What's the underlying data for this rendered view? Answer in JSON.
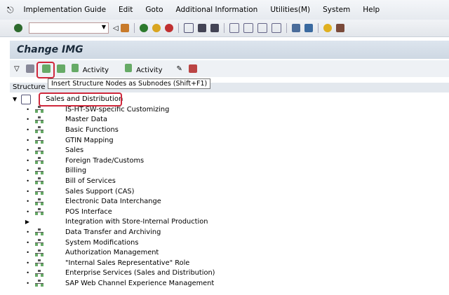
{
  "menu": [
    "Implementation Guide",
    "Edit",
    "Goto",
    "Additional Information",
    "Utilities(M)",
    "System",
    "Help"
  ],
  "command_field": "",
  "title": "Change IMG",
  "app_toolbar": {
    "activity1": "Activity",
    "activity2": "Activity"
  },
  "tooltip": "Insert Structure Nodes as Subnodes    (Shift+F1)",
  "structure_label": "Structure",
  "root": "Sales and Distribution",
  "items": [
    {
      "label": "IS-HT-SW-specific Customizing",
      "icon": true
    },
    {
      "label": "Master Data",
      "icon": true
    },
    {
      "label": "Basic Functions",
      "icon": true
    },
    {
      "label": "GTIN Mapping",
      "icon": true
    },
    {
      "label": "Sales",
      "icon": true
    },
    {
      "label": "Foreign Trade/Customs",
      "icon": true
    },
    {
      "label": "Billing",
      "icon": true
    },
    {
      "label": "Bill of Services",
      "icon": true
    },
    {
      "label": "Sales Support (CAS)",
      "icon": true
    },
    {
      "label": "Electronic Data Interchange",
      "icon": true
    },
    {
      "label": "POS Interface",
      "icon": true
    },
    {
      "label": "Integration with Store-Internal Production",
      "icon": false
    },
    {
      "label": "Data Transfer and Archiving",
      "icon": true
    },
    {
      "label": "System Modifications",
      "icon": true
    },
    {
      "label": "Authorization Management",
      "icon": true
    },
    {
      "label": "\"Internal Sales Representative\" Role",
      "icon": true
    },
    {
      "label": "Enterprise Services (Sales and Distribution)",
      "icon": true
    },
    {
      "label": "SAP Web Channel Experience Management",
      "icon": true
    }
  ]
}
